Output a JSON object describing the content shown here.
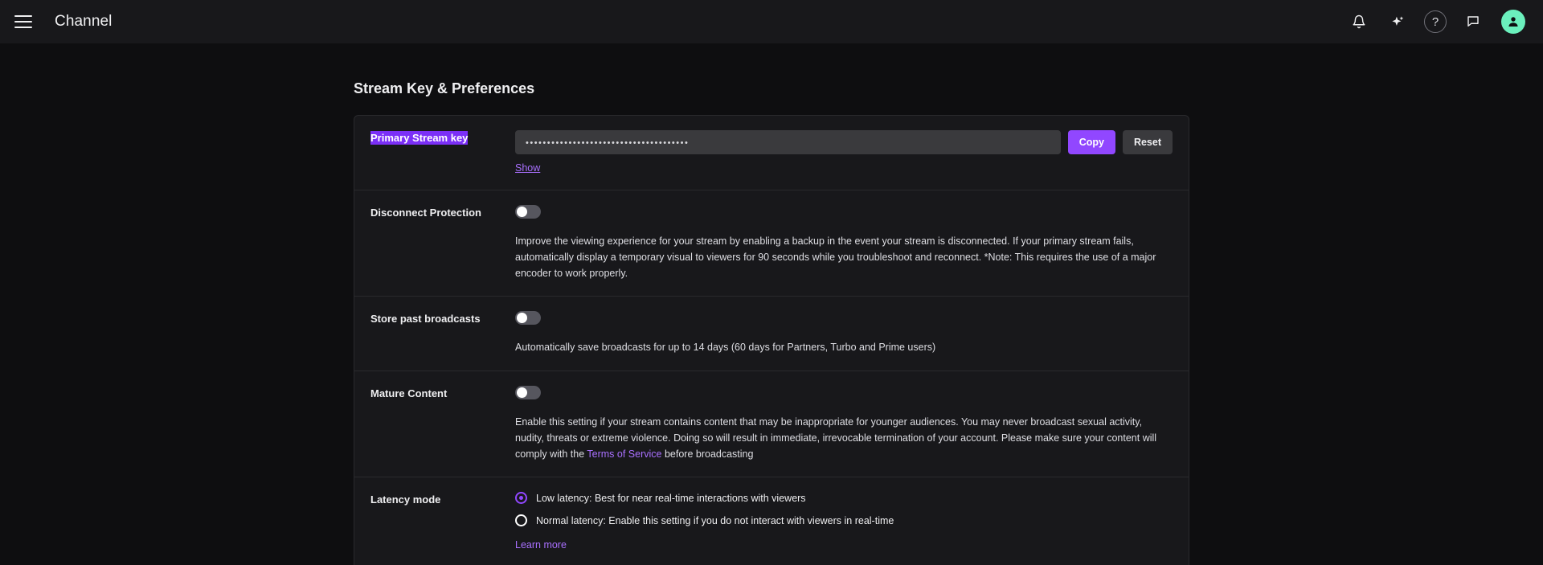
{
  "topbar": {
    "menu_icon": "hamburger-menu-icon",
    "title": "Channel",
    "actions": [
      {
        "name": "notifications",
        "icon": "bell-icon"
      },
      {
        "name": "ai-assistant",
        "icon": "sparkle-icon"
      },
      {
        "name": "help",
        "icon": "question-mark-icon",
        "label": "?"
      },
      {
        "name": "messages",
        "icon": "chat-bubble-icon"
      },
      {
        "name": "account",
        "icon": "user-avatar-icon"
      }
    ],
    "avatar_color": "#6bf0bd"
  },
  "page": {
    "title": "Stream Key & Preferences"
  },
  "stream_key": {
    "label": "Primary Stream key",
    "value": "••••••••••••••••••••••••••••••••••••••",
    "copy_label": "Copy",
    "reset_label": "Reset",
    "show_label": "Show",
    "label_highlight_color": "#7b2ff7"
  },
  "disconnect_protection": {
    "label": "Disconnect Protection",
    "toggle_state": "off",
    "description": "Improve the viewing experience for your stream by enabling a backup in the event your stream is disconnected. If your primary stream fails, automatically display a temporary visual to viewers for 90 seconds while you troubleshoot and reconnect. *Note: This requires the use of a major encoder to work properly."
  },
  "store_past_broadcasts": {
    "label": "Store past broadcasts",
    "toggle_state": "off",
    "description": "Automatically save broadcasts for up to 14 days (60 days for Partners, Turbo and Prime users)"
  },
  "mature_content": {
    "label": "Mature Content",
    "toggle_state": "off",
    "description_part1": "Enable this setting if your stream contains content that may be inappropriate for younger audiences. You may never broadcast sexual activity, nudity, threats or extreme violence. Doing so will result in immediate, irrevocable termination of your account. Please make sure your content will comply with the ",
    "terms_link": "Terms of Service",
    "description_part2": " before broadcasting"
  },
  "latency_mode": {
    "label": "Latency mode",
    "options": [
      {
        "label": "Low latency: Best for near real-time interactions with viewers",
        "selected": true
      },
      {
        "label": "Normal latency: Enable this setting if you do not interact with viewers in real-time",
        "selected": false
      }
    ],
    "learn_more_label": "Learn more"
  },
  "colors": {
    "accent_purple": "#9147ff",
    "link_purple": "#a970ff",
    "page_bg": "#0e0e10",
    "panel_bg": "#18181b"
  }
}
